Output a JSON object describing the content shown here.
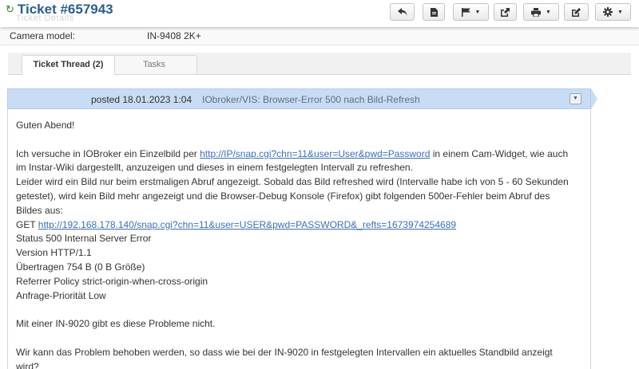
{
  "header": {
    "title": "Ticket #657943",
    "ghost_title": "Ticket Details"
  },
  "toolbar": {
    "buttons": [
      {
        "icon": "reply-icon"
      },
      {
        "icon": "document-icon"
      },
      {
        "icon": "flag-icon",
        "dropdown": true
      },
      {
        "icon": "export-icon"
      },
      {
        "icon": "print-icon",
        "dropdown": true
      },
      {
        "icon": "edit-icon"
      },
      {
        "icon": "gear-icon",
        "dropdown": true
      }
    ]
  },
  "info": {
    "label": "Camera model:",
    "value": "IN-9408 2K+"
  },
  "tabs": [
    {
      "label": "Ticket Thread (2)",
      "active": true
    },
    {
      "label": "Tasks",
      "active": false
    }
  ],
  "thread": {
    "posted": "posted 18.01.2023 1:04",
    "subject": "IObroker/VIS: Browser-Error 500 nach Bild-Refresh",
    "greeting": "Guten Abend!",
    "p1_before": "Ich versuche in IOBroker ein Einzelbild per ",
    "link1": "http://IP/snap.cgi?chn=11&user=User&pwd=Password",
    "p1_after": " in einem Cam-Widget, wie auch im Instar-Wiki dargestellt, anzuzeigen und dieses in einem festgelegten Intervall zu refreshen.",
    "p2": "Leider wird ein Bild nur beim erstmaligen Abruf angezeigt. Sobald das Bild refreshed wird (Intervalle habe ich von 5 - 60 Sekunden getestet), wird kein Bild mehr angezeigt und die Browser-Debug Konsole (Firefox) gibt folgenden 500er-Fehler beim Abruf des Bildes aus:",
    "get_prefix": "GET ",
    "link2": "http://192.168.178.140/snap.cgi?chn=11&user=USER&pwd=PASSWORD&_refts=1673974254689",
    "status": "Status 500 Internal Server Error",
    "version": "Version HTTP/1.1",
    "transferred": "Übertragen 754 B (0 B Größe)",
    "referrer": "Referrer Policy strict-origin-when-cross-origin",
    "priority": "Anfrage-Priorität Low",
    "p3": "Mit einer IN-9020 gibt es diese Probleme nicht.",
    "p4": "Wir kann das Problem behoben werden, so dass wie bei der IN-9020 in festgelegten Intervallen ein aktuelles Standbild anzeigt wird?"
  },
  "colors": {
    "title": "#2b5d8e",
    "refresh_icon": "#2a8a2a",
    "thread_header": "#c8dcf4",
    "link": "#3a6fb5"
  }
}
